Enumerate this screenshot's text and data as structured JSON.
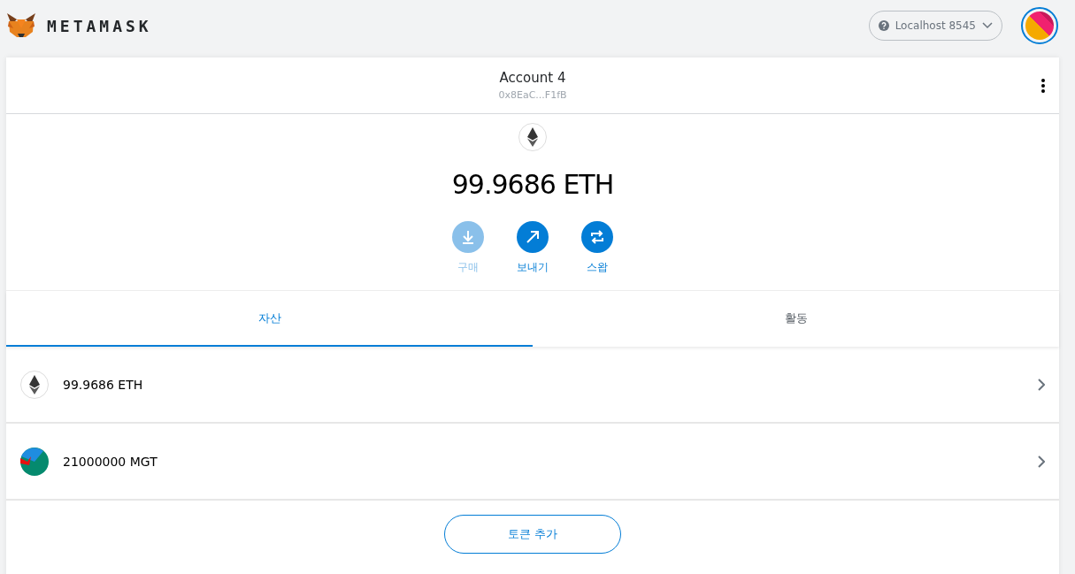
{
  "header": {
    "logo_text": "METAMASK",
    "network": {
      "label": "Localhost 8545"
    }
  },
  "account": {
    "name": "Account 4",
    "address": "0x8EaC...F1fB"
  },
  "balance": {
    "amount": "99.9686 ETH"
  },
  "actions": [
    {
      "kind": "buy",
      "label": "구매",
      "disabled": true
    },
    {
      "kind": "send",
      "label": "보내기",
      "disabled": false
    },
    {
      "kind": "swap",
      "label": "스왑",
      "disabled": false
    }
  ],
  "tabs": [
    {
      "label": "자산",
      "selected": true
    },
    {
      "label": "활동",
      "selected": false
    }
  ],
  "assets": [
    {
      "kind": "eth",
      "label": "99.9686 ETH"
    },
    {
      "kind": "token",
      "label": "21000000 MGT"
    }
  ],
  "add_token_button": "토큰 추가"
}
